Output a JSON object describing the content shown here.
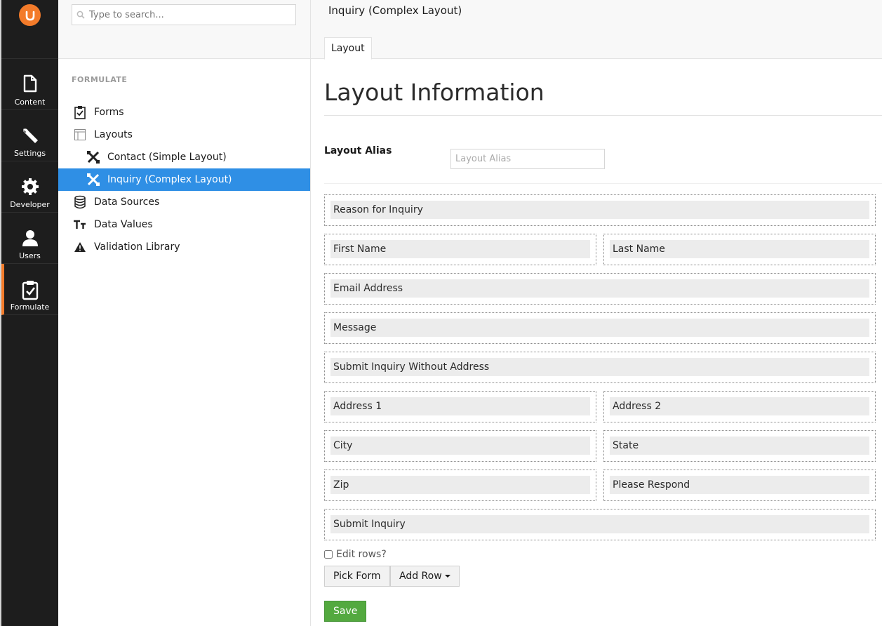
{
  "app": {
    "logo_icon": "umbraco-logo-icon",
    "accent_color": "#f37b2a",
    "sections": [
      {
        "label": "Content",
        "icon": "document-icon"
      },
      {
        "label": "Settings",
        "icon": "wrench-icon"
      },
      {
        "label": "Developer",
        "icon": "gear-icon"
      },
      {
        "label": "Users",
        "icon": "user-icon"
      },
      {
        "label": "Formulate",
        "icon": "clipboard-check-icon",
        "active": true
      }
    ]
  },
  "tree": {
    "search_placeholder": "Type to search...",
    "heading": "FORMULATE",
    "nodes": [
      {
        "label": "Forms",
        "icon": "clipboard-icon"
      },
      {
        "label": "Layouts",
        "icon": "layout-icon"
      },
      {
        "label": "Contact (Simple Layout)",
        "icon": "layout-tools-icon"
      },
      {
        "label": "Inquiry (Complex Layout)",
        "icon": "layout-tools-icon",
        "selected": true
      },
      {
        "label": "Data Sources",
        "icon": "database-icon"
      },
      {
        "label": "Data Values",
        "icon": "text-size-icon"
      },
      {
        "label": "Validation Library",
        "icon": "warning-icon"
      }
    ],
    "selected_color": "#2f8fe5"
  },
  "main": {
    "document_name": "Inquiry (Complex Layout)",
    "tab_label": "Layout",
    "heading": "Layout Information",
    "alias_label": "Layout Alias",
    "alias_placeholder": "Layout Alias",
    "alias_value": "",
    "rows": [
      {
        "cells": [
          "Reason for Inquiry"
        ]
      },
      {
        "cells": [
          "First Name",
          "Last Name"
        ]
      },
      {
        "cells": [
          "Email Address"
        ]
      },
      {
        "cells": [
          "Message"
        ]
      },
      {
        "cells": [
          "Submit Inquiry Without Address"
        ]
      },
      {
        "cells": [
          "Address 1",
          "Address 2"
        ]
      },
      {
        "cells": [
          "City",
          "State"
        ]
      },
      {
        "cells": [
          "Zip",
          "Please Respond"
        ]
      },
      {
        "cells": [
          "Submit Inquiry"
        ]
      }
    ],
    "edit_rows_label": "Edit rows?",
    "edit_rows_checked": false,
    "pick_form_label": "Pick Form",
    "add_row_label": "Add Row",
    "save_label": "Save",
    "save_color": "#53a93f"
  }
}
